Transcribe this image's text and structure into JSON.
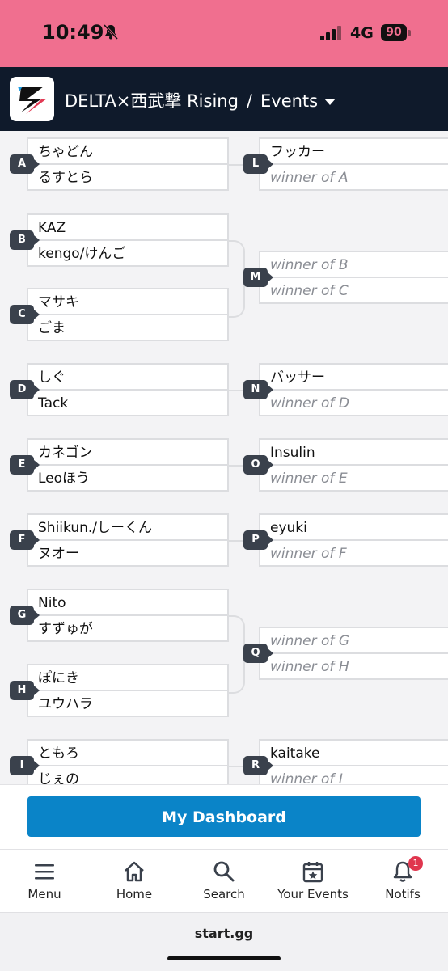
{
  "status_bar": {
    "time": "10:49",
    "network": "4G",
    "battery": "90"
  },
  "header": {
    "event_name": "DELTA×西武撃 Rising",
    "separator": "/",
    "section": "Events"
  },
  "bracket": {
    "left": [
      {
        "id": "A",
        "top": "ちゃどん",
        "bottom": "るすとら"
      },
      {
        "id": "B",
        "top": "KAZ",
        "bottom": "kengo/けんご"
      },
      {
        "id": "C",
        "top": "マサキ",
        "bottom": "ごま"
      },
      {
        "id": "D",
        "top": "しぐ",
        "bottom": "Tack"
      },
      {
        "id": "E",
        "top": "カネゴン",
        "bottom": "Leoほう"
      },
      {
        "id": "F",
        "top": "Shiikun./しーくん",
        "bottom": "ヌオー"
      },
      {
        "id": "G",
        "top": "Nito",
        "bottom": "すずゅが"
      },
      {
        "id": "H",
        "top": "ぽにき",
        "bottom": "ユウハラ"
      },
      {
        "id": "I",
        "top": "ともろ",
        "bottom": "じぇの"
      }
    ],
    "right": [
      {
        "id": "L",
        "top": "フッカー",
        "bottom": "winner of A",
        "top_placeholder": false
      },
      {
        "id": "M",
        "top": "winner of B",
        "bottom": "winner of C",
        "top_placeholder": true
      },
      {
        "id": "N",
        "top": "バッサー",
        "bottom": "winner of D",
        "top_placeholder": false
      },
      {
        "id": "O",
        "top": "Insulin",
        "bottom": "winner of E",
        "top_placeholder": false
      },
      {
        "id": "P",
        "top": "eyuki",
        "bottom": "winner of F",
        "top_placeholder": false
      },
      {
        "id": "Q",
        "top": "winner of G",
        "bottom": "winner of H",
        "top_placeholder": true
      },
      {
        "id": "R",
        "top": "kaitake",
        "bottom": "winner of I",
        "top_placeholder": false
      }
    ]
  },
  "cta": {
    "label": "My Dashboard"
  },
  "tabs": [
    {
      "label": "Menu",
      "icon": "menu-icon"
    },
    {
      "label": "Home",
      "icon": "home-icon"
    },
    {
      "label": "Search",
      "icon": "search-icon"
    },
    {
      "label": "Your Events",
      "icon": "calendar-star-icon"
    },
    {
      "label": "Notifs",
      "icon": "bell-icon",
      "badge": "1"
    }
  ],
  "browser": {
    "url": "start.gg"
  }
}
